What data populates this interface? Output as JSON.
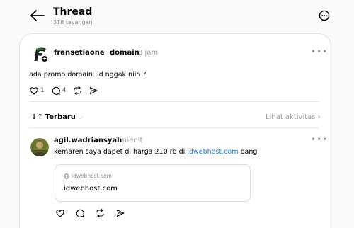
{
  "header": {
    "title": "Thread",
    "views": "318 tayangan"
  },
  "post": {
    "author": "fransetiaone",
    "separator": "›",
    "domain": "domain",
    "time": "8 jam",
    "text": "ada promo domain .id nggak niih ?",
    "likes": "1",
    "comments": "4"
  },
  "sort": {
    "label": "Terbaru",
    "activity": "Lihat aktivitas ›"
  },
  "reply": {
    "author": "agil.wadriansyah",
    "time": "1 menit",
    "text_prefix": "kemaren saya dapet di harga 210 rb di ",
    "link": "idwebhost.com",
    "text_suffix": " bang",
    "preview": {
      "host": "idwebhost.com",
      "title": "idwebhost.com"
    }
  },
  "icons": {
    "back": "arrow-left-icon",
    "more": "more-circle-icon",
    "like": "heart-icon",
    "comment": "comment-icon",
    "repost": "repost-icon",
    "share": "send-icon"
  }
}
